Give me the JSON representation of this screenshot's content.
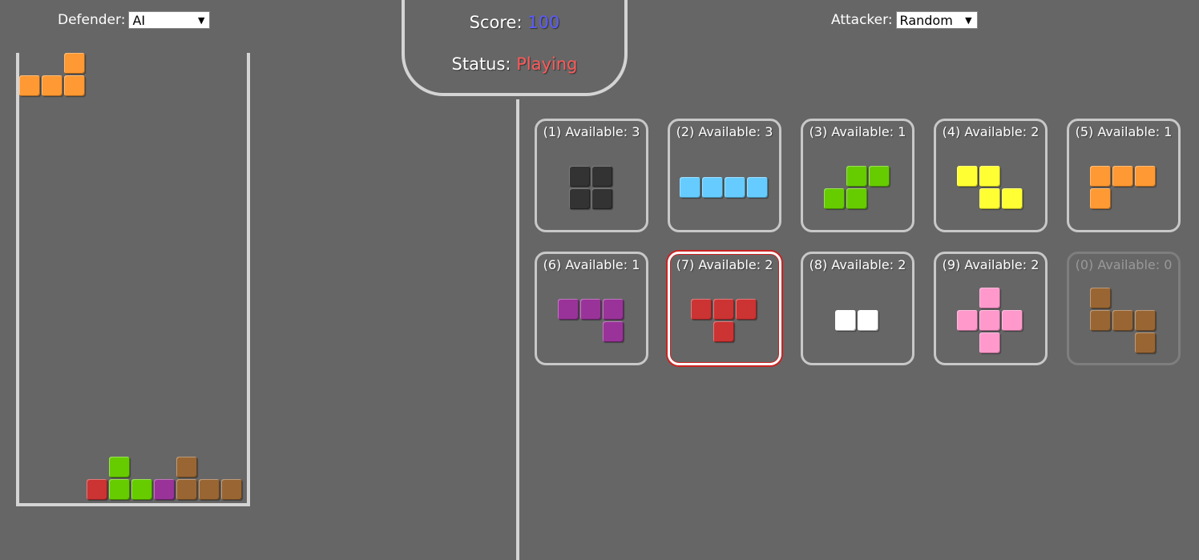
{
  "defender": {
    "label": "Defender:",
    "value": "AI"
  },
  "attacker": {
    "label": "Attacker:",
    "value": "Random"
  },
  "score": {
    "label": "Score:",
    "value": "100",
    "value_color": "#5b5bff"
  },
  "status": {
    "label": "Status:",
    "value": "Playing",
    "value_color": "#ff5a5a"
  },
  "colors": {
    "orange": "#ff9933",
    "green": "#66cc00",
    "red": "#cc3333",
    "purple": "#993399",
    "brown": "#996633",
    "black": "#333333",
    "cyan": "#66ccff",
    "yellow": "#ffff33",
    "white": "#ffffff",
    "pink": "#ff99cc",
    "board_border": "#d4d4d4",
    "background": "#666666"
  },
  "board": {
    "columns": 10,
    "rows": 20,
    "cells": [
      {
        "row": 0,
        "col": 2,
        "color": "orange"
      },
      {
        "row": 1,
        "col": 0,
        "color": "orange"
      },
      {
        "row": 1,
        "col": 1,
        "color": "orange"
      },
      {
        "row": 1,
        "col": 2,
        "color": "orange"
      },
      {
        "row": 18,
        "col": 4,
        "color": "green"
      },
      {
        "row": 18,
        "col": 7,
        "color": "brown"
      },
      {
        "row": 19,
        "col": 3,
        "color": "red"
      },
      {
        "row": 19,
        "col": 4,
        "color": "green"
      },
      {
        "row": 19,
        "col": 5,
        "color": "green"
      },
      {
        "row": 19,
        "col": 6,
        "color": "purple"
      },
      {
        "row": 19,
        "col": 7,
        "color": "brown"
      },
      {
        "row": 19,
        "col": 8,
        "color": "brown"
      },
      {
        "row": 19,
        "col": 9,
        "color": "brown"
      }
    ]
  },
  "pieces": [
    {
      "key": "1",
      "label": "(1) Available: 3",
      "available": 3,
      "color": "black",
      "shape": "O",
      "cells": [
        [
          0,
          0
        ],
        [
          0,
          1
        ],
        [
          1,
          0
        ],
        [
          1,
          1
        ]
      ],
      "selected": false
    },
    {
      "key": "2",
      "label": "(2) Available: 3",
      "available": 3,
      "color": "cyan",
      "shape": "I",
      "cells": [
        [
          0,
          0
        ],
        [
          0,
          1
        ],
        [
          0,
          2
        ],
        [
          0,
          3
        ]
      ],
      "selected": false
    },
    {
      "key": "3",
      "label": "(3) Available: 1",
      "available": 1,
      "color": "green",
      "shape": "S",
      "cells": [
        [
          0,
          1
        ],
        [
          0,
          2
        ],
        [
          1,
          0
        ],
        [
          1,
          1
        ]
      ],
      "selected": false
    },
    {
      "key": "4",
      "label": "(4) Available: 2",
      "available": 2,
      "color": "yellow",
      "shape": "Z",
      "cells": [
        [
          0,
          0
        ],
        [
          0,
          1
        ],
        [
          1,
          1
        ],
        [
          1,
          2
        ]
      ],
      "selected": false
    },
    {
      "key": "5",
      "label": "(5) Available: 1",
      "available": 1,
      "color": "orange",
      "shape": "L",
      "cells": [
        [
          0,
          0
        ],
        [
          0,
          1
        ],
        [
          0,
          2
        ],
        [
          1,
          0
        ]
      ],
      "selected": false
    },
    {
      "key": "6",
      "label": "(6) Available: 1",
      "available": 1,
      "color": "purple",
      "shape": "J",
      "cells": [
        [
          0,
          0
        ],
        [
          0,
          1
        ],
        [
          0,
          2
        ],
        [
          1,
          2
        ]
      ],
      "selected": false
    },
    {
      "key": "7",
      "label": "(7) Available: 2",
      "available": 2,
      "color": "red",
      "shape": "T",
      "cells": [
        [
          0,
          0
        ],
        [
          0,
          1
        ],
        [
          0,
          2
        ],
        [
          1,
          1
        ]
      ],
      "selected": true
    },
    {
      "key": "8",
      "label": "(8) Available: 2",
      "available": 2,
      "color": "white",
      "shape": "domino",
      "cells": [
        [
          0,
          0
        ],
        [
          0,
          1
        ]
      ],
      "selected": false
    },
    {
      "key": "9",
      "label": "(9) Available: 2",
      "available": 2,
      "color": "pink",
      "shape": "plus",
      "cells": [
        [
          0,
          1
        ],
        [
          1,
          0
        ],
        [
          1,
          1
        ],
        [
          1,
          2
        ],
        [
          2,
          1
        ]
      ],
      "selected": false
    },
    {
      "key": "0",
      "label": "(0) Available: 0",
      "available": 0,
      "color": "brown",
      "shape": "U",
      "cells": [
        [
          0,
          0
        ],
        [
          1,
          0
        ],
        [
          1,
          1
        ],
        [
          1,
          2
        ],
        [
          2,
          2
        ]
      ],
      "selected": false
    }
  ]
}
